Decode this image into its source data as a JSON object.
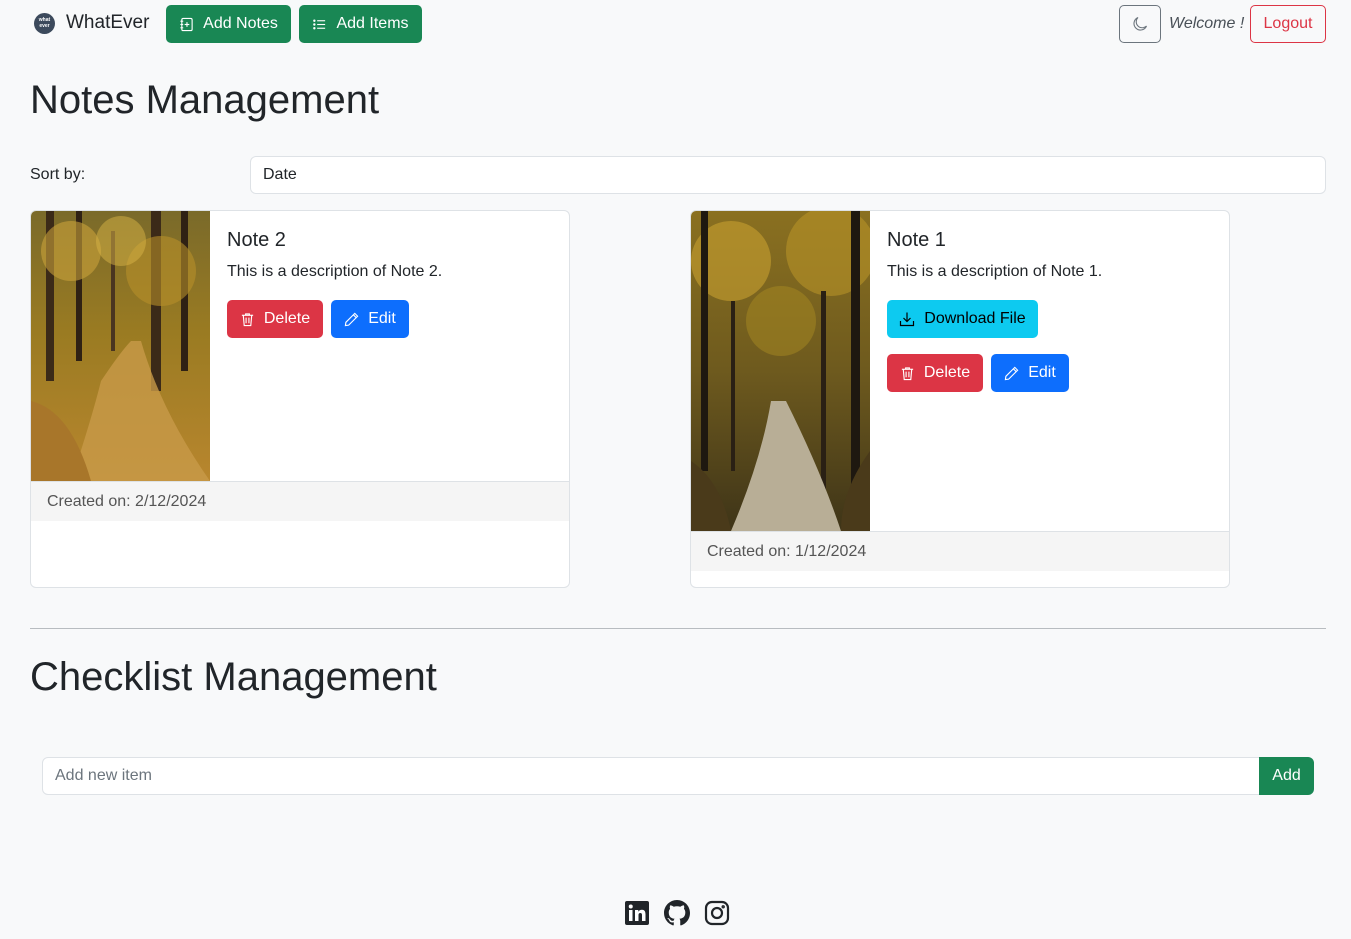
{
  "navbar": {
    "brand_logo_text": "what ever",
    "brand": "WhatEver",
    "add_notes": "Add Notes",
    "add_items": "Add Items",
    "welcome": "Welcome !",
    "logout": "Logout"
  },
  "notes": {
    "heading": "Notes Management",
    "sort_label": "Sort by:",
    "sort_value": "Date",
    "cards": [
      {
        "title": "Note 2",
        "description": "This is a description of Note 2.",
        "delete": "Delete",
        "edit": "Edit",
        "created": "Created on: 2/12/2024"
      },
      {
        "title": "Note 1",
        "description": "This is a description of Note 1.",
        "download": "Download File",
        "delete": "Delete",
        "edit": "Edit",
        "created": "Created on: 1/12/2024"
      }
    ]
  },
  "checklist": {
    "heading": "Checklist Management",
    "placeholder": "Add new item",
    "add_button": "Add"
  },
  "colors": {
    "success": "#198754",
    "danger": "#dc3545",
    "primary": "#0d6efd",
    "info": "#0dcaf0",
    "background": "#f8f9fa"
  },
  "footer": {
    "icons": [
      "linkedin-icon",
      "github-icon",
      "instagram-icon"
    ]
  }
}
